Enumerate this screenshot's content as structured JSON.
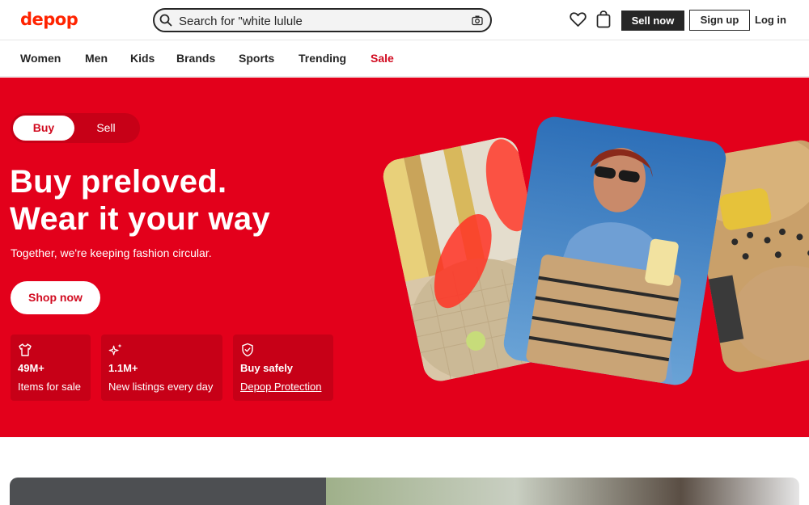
{
  "header": {
    "logo": "depop",
    "search_value": "Search for \"white lulule",
    "sell_label": "Sell now",
    "signup_label": "Sign up",
    "login_label": "Log in"
  },
  "nav": {
    "items": [
      "Women",
      "Men",
      "Kids",
      "Brands",
      "Sports",
      "Trending",
      "Sale"
    ]
  },
  "hero": {
    "toggle_buy": "Buy",
    "toggle_sell": "Sell",
    "title_line1": "Buy preloved.",
    "title_line2": "Wear it your way",
    "subtitle": "Together, we're keeping fashion circular.",
    "cta": "Shop now",
    "stats": [
      {
        "icon": "tshirt-icon",
        "title": "49M+",
        "label": "Items for sale"
      },
      {
        "icon": "sparkle-icon",
        "title": "1.1M+",
        "label": "New listings every day"
      },
      {
        "icon": "shield-icon",
        "title": "Buy safely",
        "label": "Depop Protection"
      }
    ]
  },
  "colors": {
    "brand_red": "#e3001b",
    "logo_red": "#ff2300",
    "dark": "#262626"
  }
}
